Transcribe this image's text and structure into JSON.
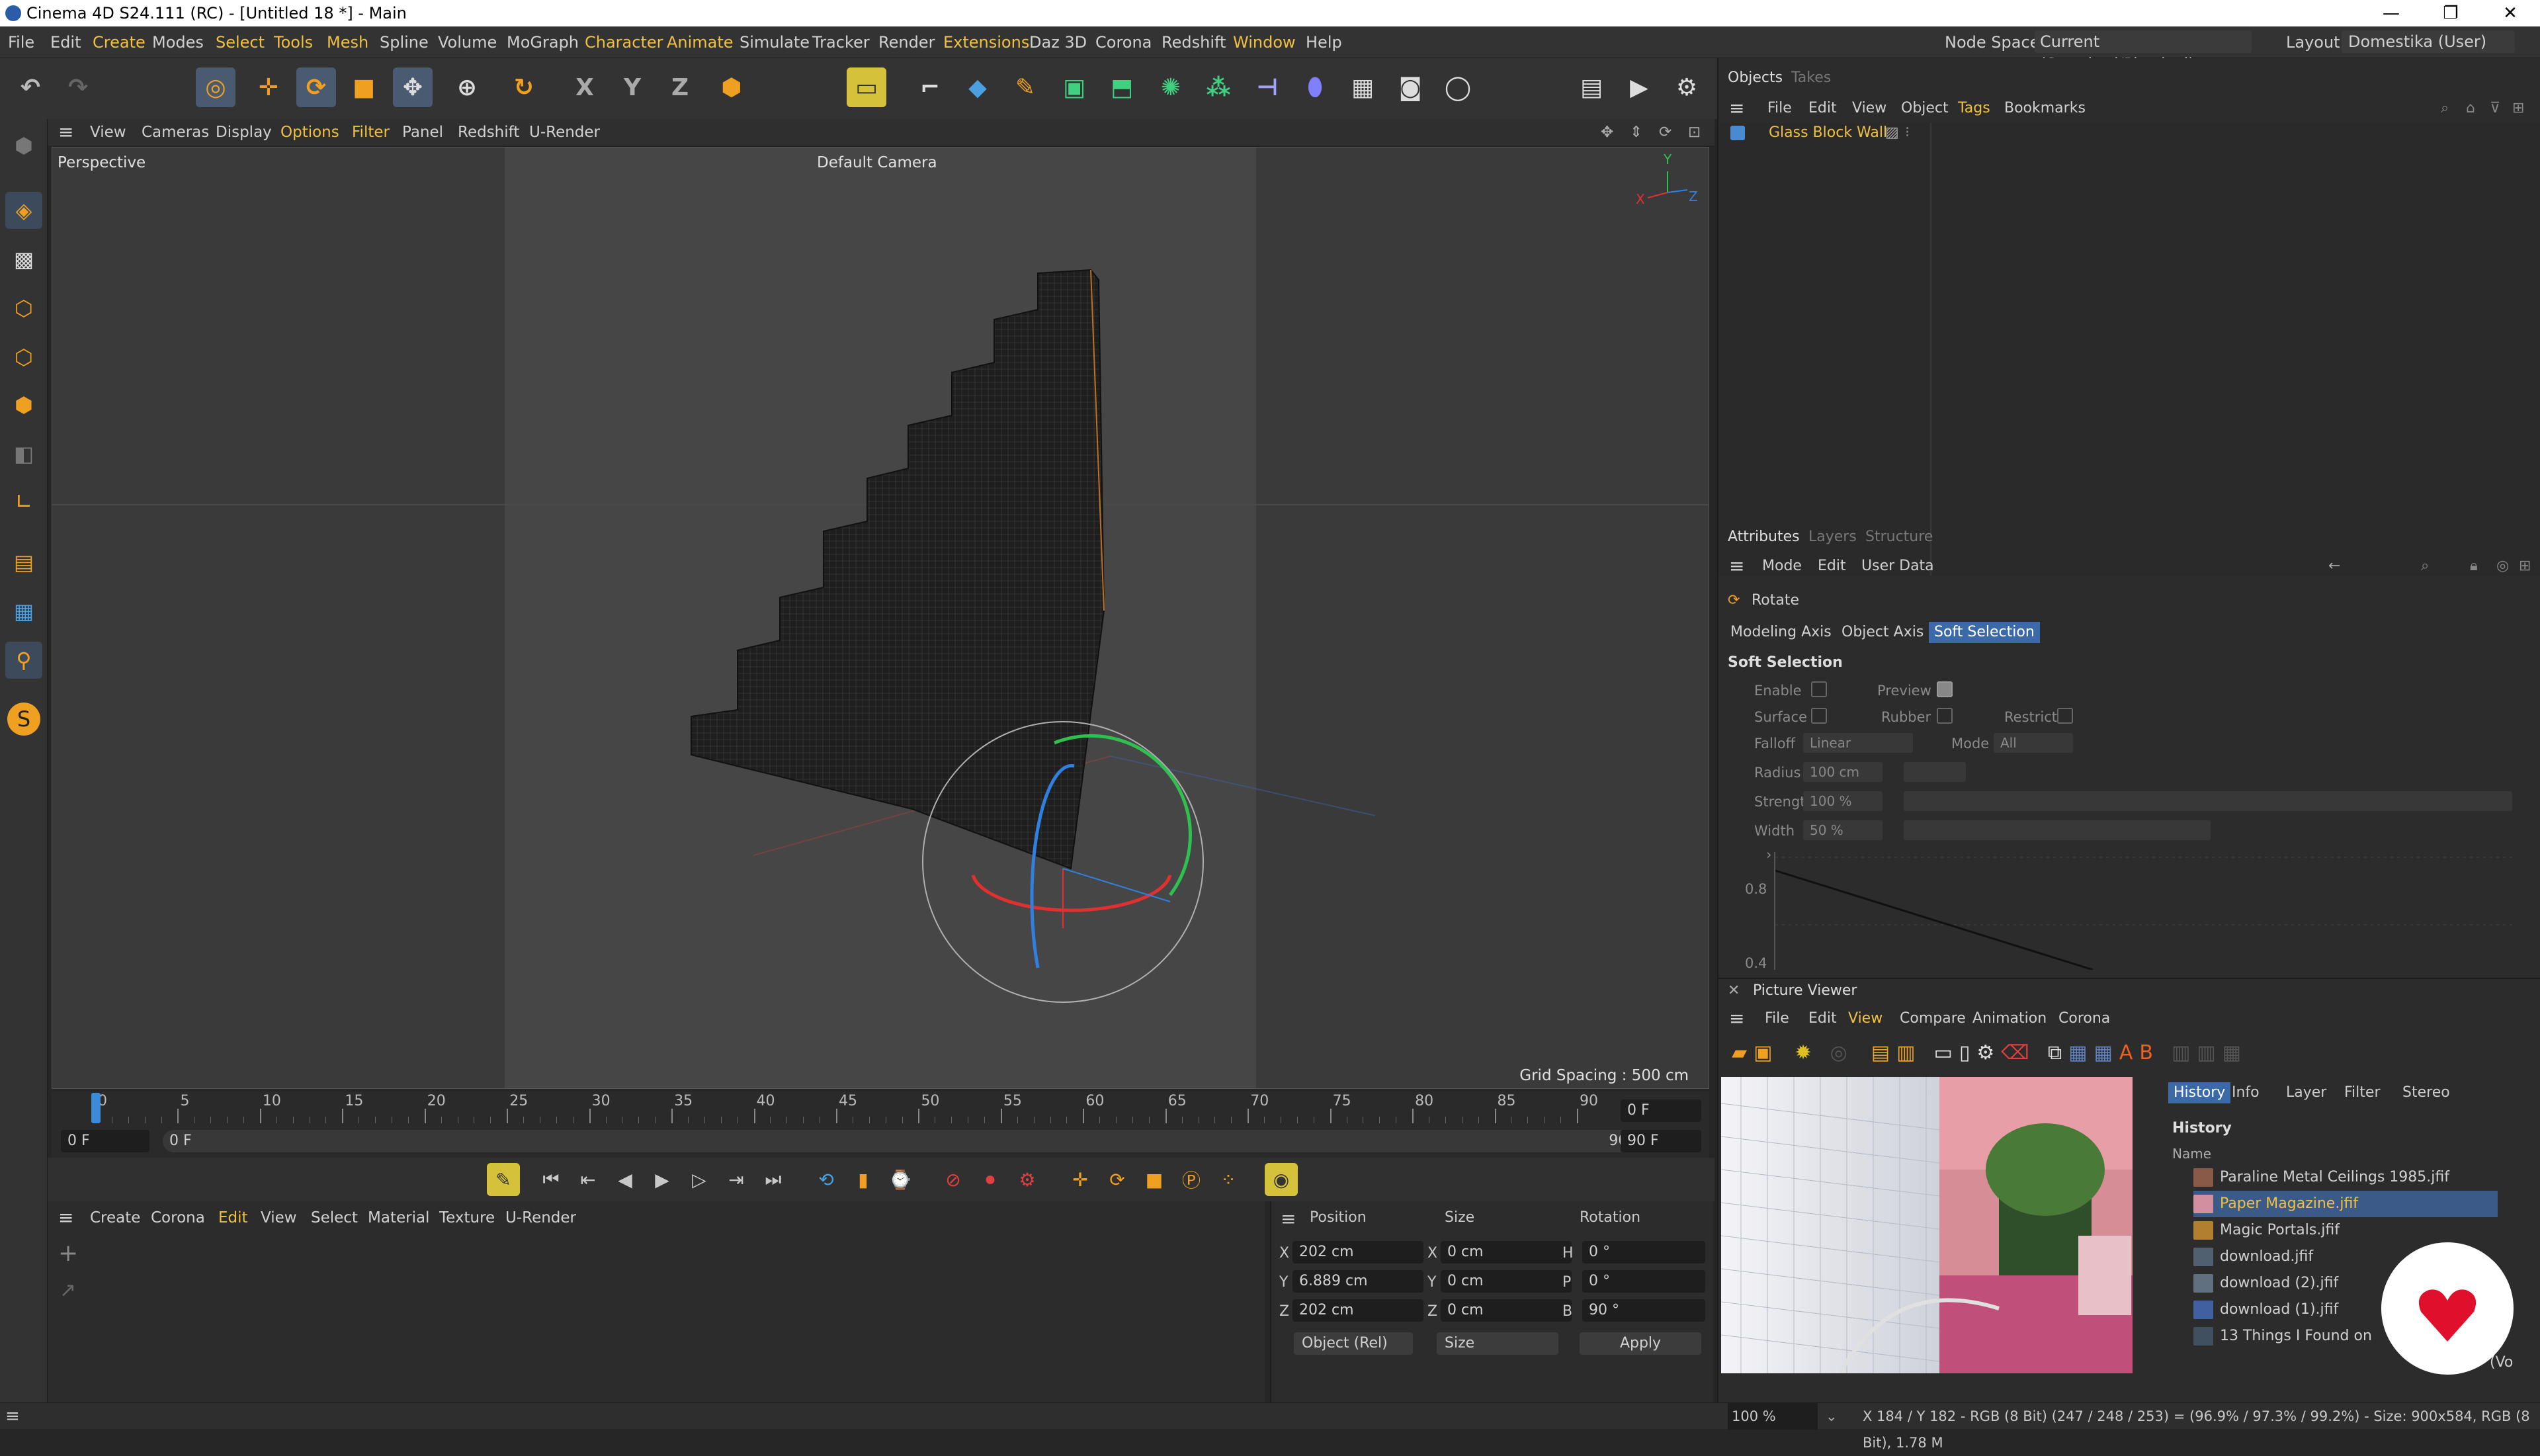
{
  "window": {
    "title": "Cinema 4D S24.111 (RC) - [Untitled 18 *] - Main",
    "controls": [
      "—",
      "❐",
      "✕"
    ]
  },
  "menubar": {
    "items": [
      "File",
      "Edit",
      "Create",
      "Modes",
      "Select",
      "Tools",
      "Mesh",
      "Spline",
      "Volume",
      "MoGraph",
      "Character",
      "Animate",
      "Simulate",
      "Tracker",
      "Render",
      "Extensions",
      "Daz 3D",
      "Corona",
      "Redshift",
      "Window",
      "Help"
    ],
    "node_space_label": "Node Space:",
    "node_space_value": "Current (Standard/Physical)",
    "layout_label": "Layout:",
    "layout_value": "Domestika (User)"
  },
  "viewport_menu": {
    "items": [
      "View",
      "Cameras",
      "Display",
      "Options",
      "Filter",
      "Panel",
      "Redshift",
      "U-Render"
    ]
  },
  "viewport": {
    "name": "Perspective",
    "camera": "Default Camera",
    "grid_spacing": "Grid Spacing : 500 cm",
    "axis_labels": {
      "x": "X",
      "y": "Y",
      "z": "Z"
    }
  },
  "timeline": {
    "ticks": [
      "0",
      "5",
      "10",
      "15",
      "20",
      "25",
      "30",
      "35",
      "40",
      "45",
      "50",
      "55",
      "60",
      "65",
      "70",
      "75",
      "80",
      "85",
      "90"
    ],
    "current_frame": "0 F",
    "start_field": "0 F",
    "range_start": "0 F",
    "range_end": "90 F",
    "end_field": "90 F",
    "max_field": "90 F"
  },
  "material_manager": {
    "menu": [
      "Create",
      "Corona",
      "Edit",
      "View",
      "Select",
      "Material",
      "Texture",
      "U-Render"
    ]
  },
  "coordinates": {
    "headers": {
      "position": "Position",
      "size": "Size",
      "rotation": "Rotation"
    },
    "rows": [
      {
        "axis": "X",
        "pos": "202 cm",
        "size_axis": "X",
        "size": "0 cm",
        "rot_axis": "H",
        "rot": "0 °"
      },
      {
        "axis": "Y",
        "pos": "6.889 cm",
        "size_axis": "Y",
        "size": "0 cm",
        "rot_axis": "P",
        "rot": "0 °"
      },
      {
        "axis": "Z",
        "pos": "202 cm",
        "size_axis": "Z",
        "size": "0 cm",
        "rot_axis": "B",
        "rot": "90 °"
      }
    ],
    "mode_dropdown": "Object (Rel)",
    "size_dropdown": "Size",
    "apply_label": "Apply"
  },
  "objects_panel": {
    "tabs": [
      "Objects",
      "Takes"
    ],
    "menu": [
      "File",
      "Edit",
      "View",
      "Object",
      "Tags",
      "Bookmarks"
    ],
    "object_name": "Glass Block Wall"
  },
  "attributes_panel": {
    "tabs": [
      "Attributes",
      "Layers",
      "Structure"
    ],
    "menu": [
      "Mode",
      "Edit",
      "User Data"
    ],
    "tool_name": "Rotate",
    "subtabs": [
      "Modeling Axis",
      "Object Axis",
      "Soft Selection"
    ],
    "section_title": "Soft Selection",
    "labels": {
      "enable": "Enable",
      "preview": "Preview",
      "surface": "Surface",
      "rubber": "Rubber",
      "restrict": "Restrict",
      "falloff": "Falloff",
      "falloff_value": "Linear",
      "mode": "Mode",
      "mode_value": "All",
      "radius": "Radius",
      "radius_value": "100 cm",
      "strength": "Strength",
      "strength_value": "100 %",
      "width": "Width",
      "width_value": "50 %"
    },
    "graph_labels": [
      "0.8",
      "0.4"
    ],
    "graph_arrow": "›"
  },
  "picture_viewer": {
    "title": "Picture Viewer",
    "menu": [
      "File",
      "Edit",
      "View",
      "Compare",
      "Animation",
      "Corona"
    ],
    "side_tabs": [
      "History",
      "Info",
      "Layer",
      "Filter",
      "Stereo"
    ],
    "history_title": "History",
    "history_col": "Name",
    "history_items": [
      "Paraline Metal Ceilings 1985.jfif",
      "Paper Magazine.jfif",
      "Magic Portals.jfif",
      "download.jfif",
      "download (2).jfif",
      "download (1).jfif",
      "13 Things I Found on"
    ],
    "history_truncated_tail": "y (Vo",
    "zoom": "100 %",
    "status": "X 184 / Y 182 - RGB (8 Bit) (247 / 248 / 253) = (96.9% / 97.3% / 99.2%) - Size: 900x584, RGB (8 Bit), 1.78 M"
  },
  "toolbar_glyphs": {
    "x_axis": "X",
    "y_axis": "Y",
    "z_axis": "Z",
    "soft": "S"
  }
}
